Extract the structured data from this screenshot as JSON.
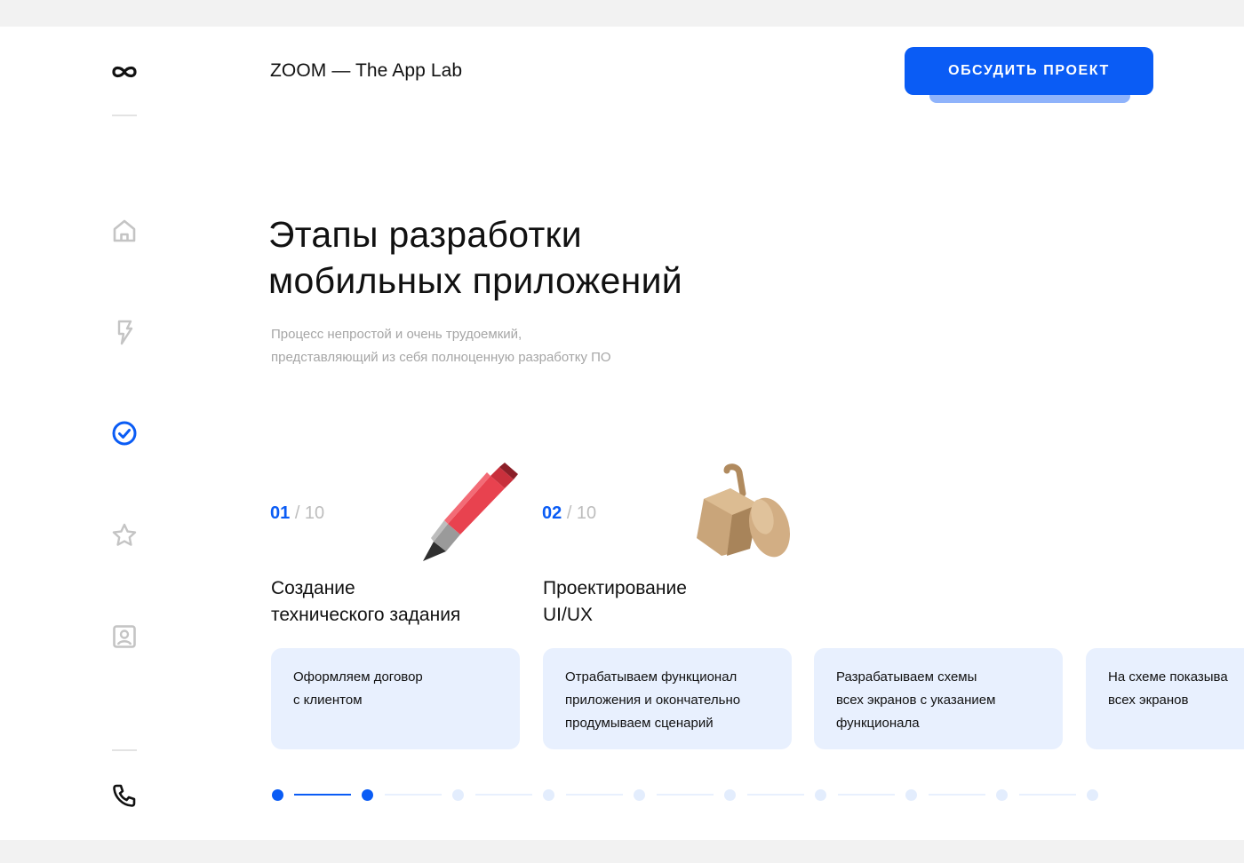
{
  "header": {
    "brand": "ZOOM — The App Lab",
    "cta_label": "ОБСУДИТЬ ПРОЕКТ"
  },
  "sidebar": {
    "items": [
      {
        "icon": "infinity-logo-icon"
      },
      {
        "icon": "home-icon"
      },
      {
        "icon": "lightning-icon"
      },
      {
        "icon": "check-circle-icon",
        "active": true
      },
      {
        "icon": "star-icon"
      },
      {
        "icon": "contact-card-icon"
      },
      {
        "icon": "phone-icon"
      }
    ]
  },
  "hero": {
    "title_line1": "Этапы разработки",
    "title_line2": "мобильных приложений",
    "subtitle_line1": "Процесс непростой и очень трудоемкий,",
    "subtitle_line2": "представляющий из себя полноценную разработку ПО"
  },
  "steps": [
    {
      "num": "01",
      "total": "/ 10",
      "title_line1": "Создание",
      "title_line2": "технического задания",
      "desc_line1": "Оформляем договор",
      "desc_line2": "с клиентом",
      "desc_line3": "",
      "illustration": "pencil"
    },
    {
      "num": "02",
      "total": "/ 10",
      "title_line1": "Проектирование",
      "title_line2": "UI/UX",
      "desc_line1": "Отрабатываем функционал",
      "desc_line2": "приложения и окончательно",
      "desc_line3": "продумываем сценарий",
      "illustration": "cardboard-mug"
    },
    {
      "desc_line1": "Разрабатываем схемы",
      "desc_line2": "всех экранов с указанием",
      "desc_line3": "функционала"
    },
    {
      "desc_line1": "На схеме показыва",
      "desc_line2": "всех экранов",
      "desc_line3": ""
    }
  ],
  "pager": {
    "total": 10,
    "active": [
      1,
      2
    ]
  },
  "colors": {
    "accent": "#0a5cf5",
    "card_bg": "#e8f0fe",
    "muted": "#a6a6a6"
  }
}
